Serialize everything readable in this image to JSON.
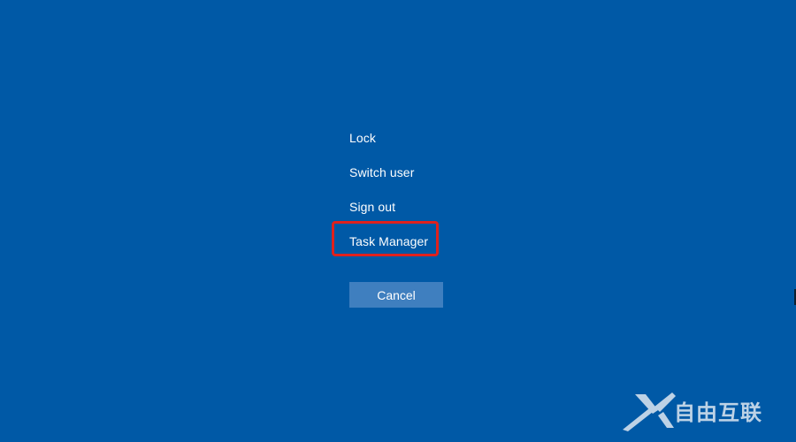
{
  "screen": {
    "background": "#0059a6",
    "accent_highlight": "#e0211d",
    "button_color": "#3f7fbf"
  },
  "menu": {
    "items": [
      {
        "id": "lock",
        "label": "Lock"
      },
      {
        "id": "switch-user",
        "label": "Switch user"
      },
      {
        "id": "sign-out",
        "label": "Sign out"
      },
      {
        "id": "task-manager",
        "label": "Task Manager",
        "highlighted": true
      }
    ]
  },
  "cancel": {
    "label": "Cancel"
  },
  "watermark": {
    "icon": "x-logo-icon",
    "text": "自由互联"
  }
}
